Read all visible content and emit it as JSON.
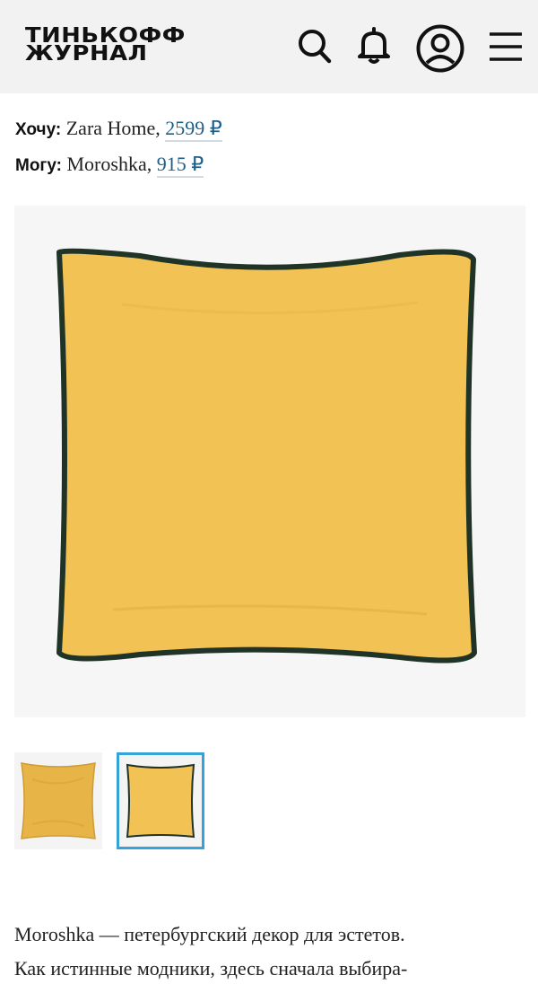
{
  "header": {
    "logo_line1": "ТИНЬКОФФ",
    "logo_line2": "ЖУРНАЛ",
    "icons": [
      "search-icon",
      "bell-icon",
      "profile-icon",
      "menu-icon"
    ]
  },
  "prices": [
    {
      "label": "Хочу:",
      "shop": "Zara Home,",
      "price": "2599 ₽"
    },
    {
      "label": "Могу:",
      "shop": "Moroshka,",
      "price": "915 ₽"
    }
  ],
  "gallery": {
    "main_image": "yellow-velvet-cushion-with-dark-green-piping",
    "thumbnails": [
      "yellow-cushion-thumb",
      "yellow-cushion-green-piping-thumb"
    ],
    "active_thumb": 1,
    "colors": {
      "cushion": "#f2c255",
      "piping": "#1f3327",
      "active_border": "#35a3d8"
    }
  },
  "article": {
    "line1": "Moroshka — петербургский декор для эстетов.",
    "line2": "Как истинные модники, здесь сначала выбира-"
  }
}
